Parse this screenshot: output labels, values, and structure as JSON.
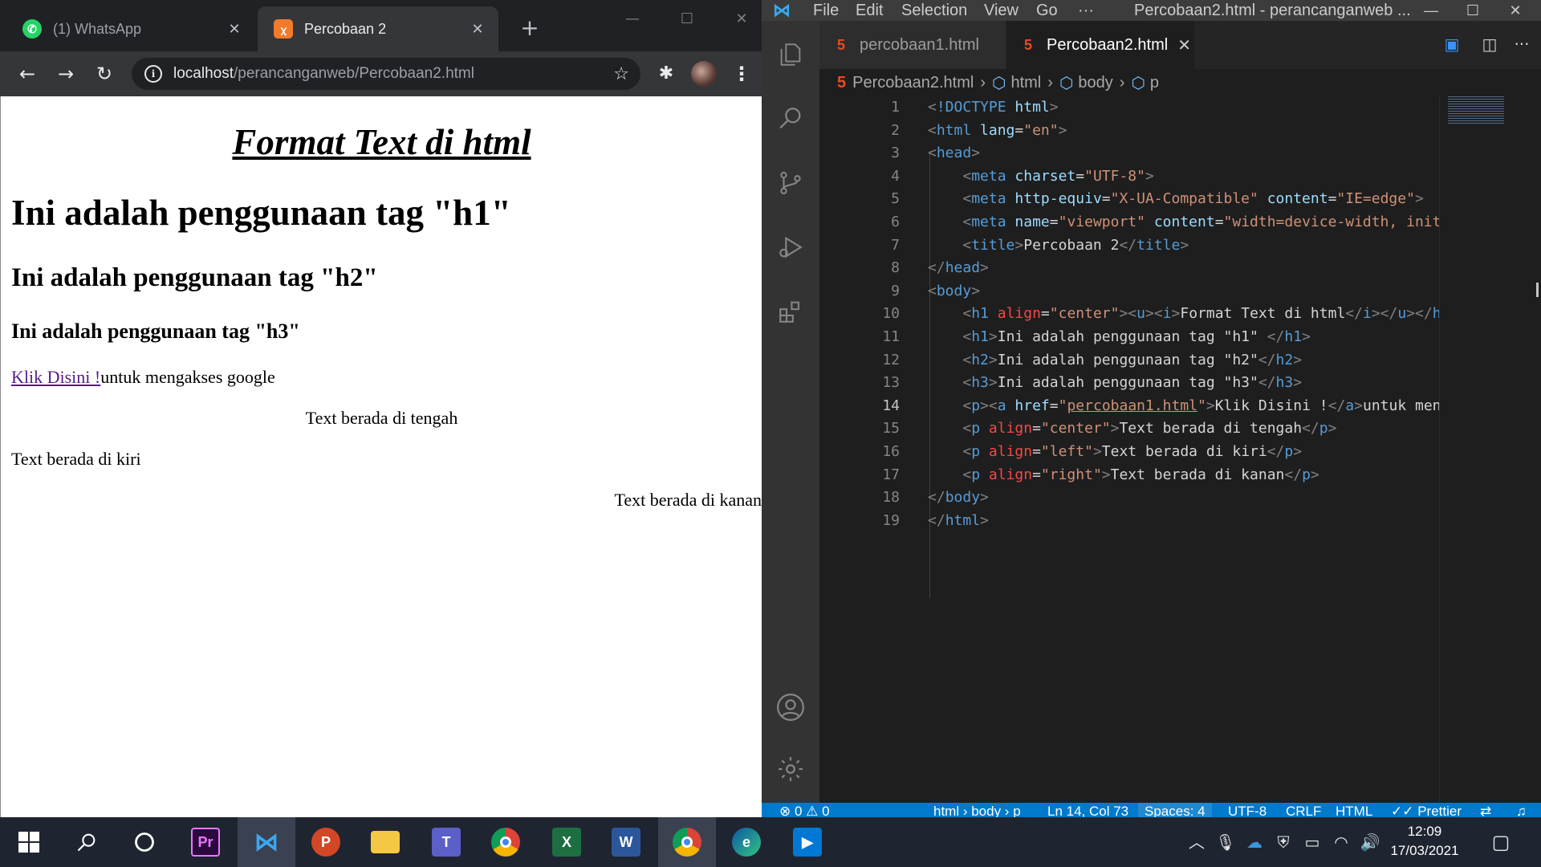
{
  "chrome": {
    "tabs": [
      {
        "title": "(1) WhatsApp",
        "icon": "whatsapp-icon"
      },
      {
        "title": "Percobaan 2",
        "icon": "xampp-icon"
      }
    ],
    "url_host": "localhost",
    "url_path": "/perancanganweb/Percobaan2.html"
  },
  "page": {
    "h1_center": "Format Text di html",
    "h1": "Ini adalah penggunaan tag \"h1\"",
    "h2": "Ini adalah penggunaan tag \"h2\"",
    "h3": "Ini adalah penggunaan tag \"h3\"",
    "link": "Klik Disini !",
    "link_after": "untuk mengakses google",
    "p_center": "Text berada di tengah",
    "p_left": "Text berada di kiri",
    "p_right": "Text berada di kanan",
    "link_color": "#551a8b"
  },
  "vscode": {
    "menu": [
      "File",
      "Edit",
      "Selection",
      "View",
      "Go",
      "···"
    ],
    "window_title": "Percobaan2.html - perancanganweb ...",
    "tabs": [
      {
        "title": "percobaan1.html",
        "active": false
      },
      {
        "title": "Percobaan2.html",
        "active": true
      }
    ],
    "breadcrumb": [
      "Percobaan2.html",
      "html",
      "body",
      "p"
    ],
    "line_numbers": [
      "1",
      "2",
      "3",
      "4",
      "5",
      "6",
      "7",
      "8",
      "9",
      "10",
      "11",
      "12",
      "13",
      "14",
      "15",
      "16",
      "17",
      "18",
      "19"
    ],
    "active_line": "14",
    "status": {
      "problems": "⊗ 0 ⚠ 0",
      "path": "html › body › p",
      "position": "Ln 14, Col 73",
      "spaces": "Spaces: 4",
      "encoding": "UTF-8",
      "eol": "CRLF",
      "language": "HTML",
      "formatter": "✓✓ Prettier"
    },
    "accent": "#007acc"
  },
  "taskbar": {
    "time": "12:09",
    "date": "17/03/2021",
    "apps": [
      "start-icon",
      "search-icon",
      "cortana-icon",
      "premiere-icon",
      "vscode-icon",
      "powerpoint-icon",
      "explorer-icon",
      "teams-icon",
      "chrome-icon",
      "excel-icon",
      "word-icon",
      "chrome-profile-icon",
      "edge-icon",
      "media-player-icon"
    ]
  }
}
